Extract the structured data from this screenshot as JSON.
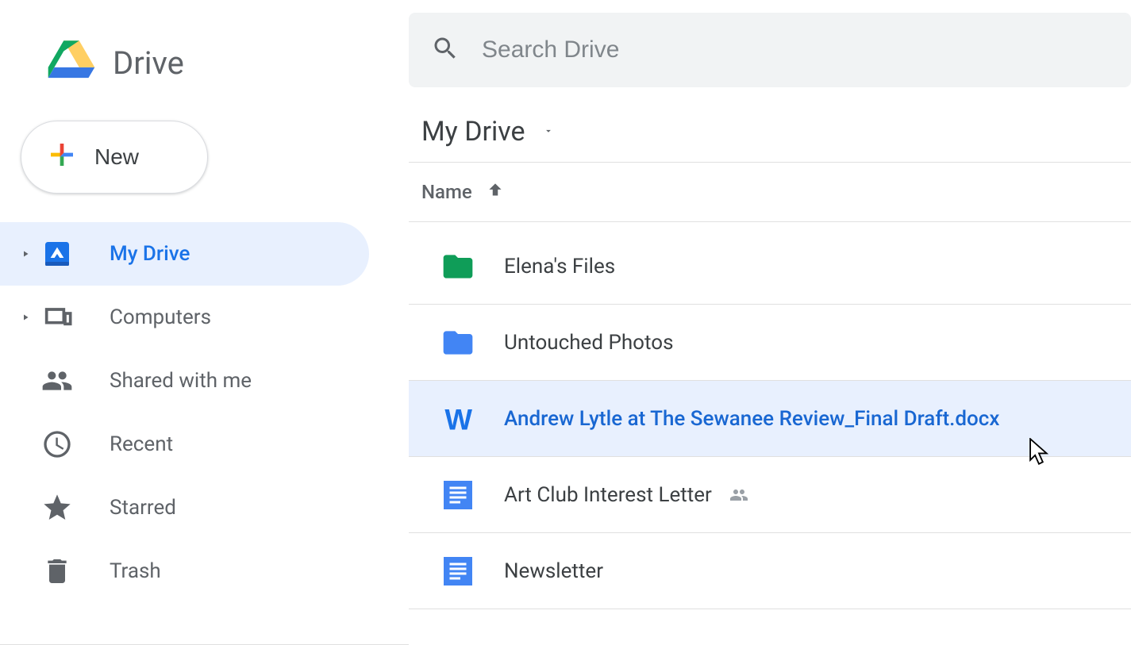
{
  "app_name": "Drive",
  "new_button_label": "New",
  "search_placeholder": "Search Drive",
  "sidebar": {
    "items": [
      {
        "label": "My Drive",
        "icon": "drive",
        "active": true,
        "expandable": true
      },
      {
        "label": "Computers",
        "icon": "computers",
        "active": false,
        "expandable": true
      },
      {
        "label": "Shared with me",
        "icon": "shared",
        "active": false,
        "expandable": false
      },
      {
        "label": "Recent",
        "icon": "recent",
        "active": false,
        "expandable": false
      },
      {
        "label": "Starred",
        "icon": "starred",
        "active": false,
        "expandable": false
      },
      {
        "label": "Trash",
        "icon": "trash",
        "active": false,
        "expandable": false
      }
    ]
  },
  "breadcrumb": "My Drive",
  "column_header": "Name",
  "sort_direction": "asc",
  "files": [
    {
      "name": "Elena's Files",
      "type": "folder",
      "color": "#0f9d58",
      "selected": false,
      "shared": false
    },
    {
      "name": "Untouched Photos",
      "type": "folder",
      "color": "#4285f4",
      "selected": false,
      "shared": false
    },
    {
      "name": "Andrew Lytle at The Sewanee Review_Final Draft.docx",
      "type": "word",
      "color": "#1a73e8",
      "selected": true,
      "shared": false
    },
    {
      "name": "Art Club Interest Letter",
      "type": "gdoc",
      "color": "#4285f4",
      "selected": false,
      "shared": true
    },
    {
      "name": "Newsletter",
      "type": "gdoc",
      "color": "#4285f4",
      "selected": false,
      "shared": false
    }
  ]
}
